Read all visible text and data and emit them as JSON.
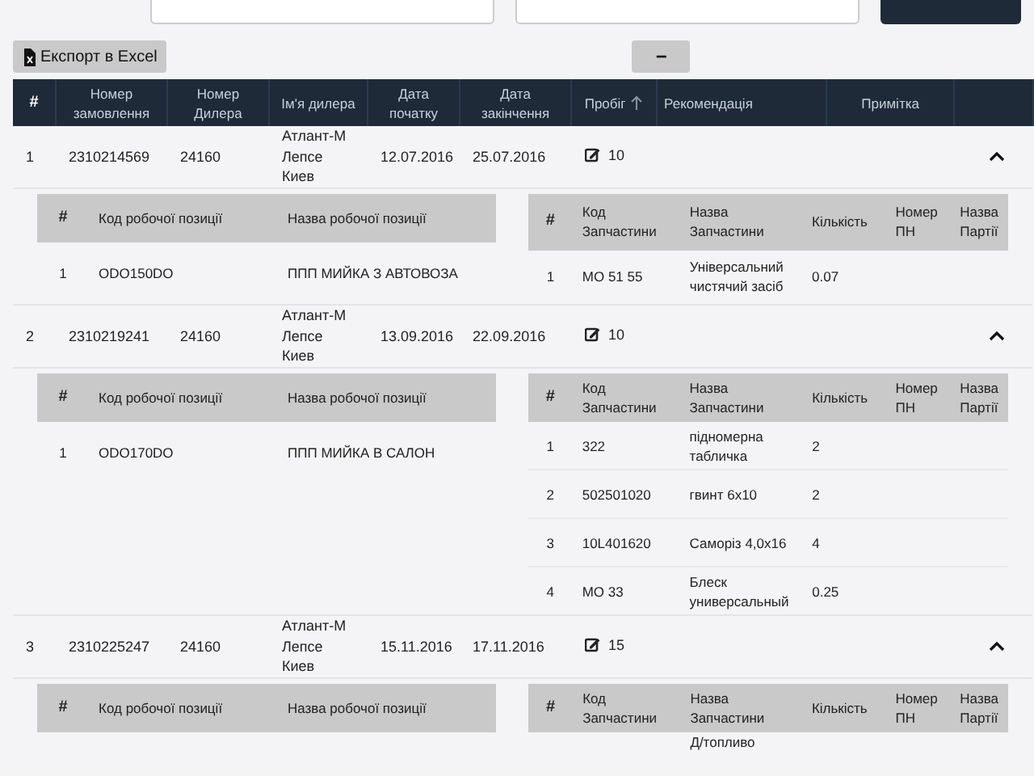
{
  "export_button": "Експорт в Excel",
  "collapse_button": "−",
  "table": {
    "columns": [
      {
        "label": "#",
        "sorted": false
      },
      {
        "label": "Номер замовлення",
        "sorted": false
      },
      {
        "label": "Номер Дилера",
        "sorted": false
      },
      {
        "label": "Ім'я дилера",
        "sorted": false
      },
      {
        "label": "Дата початку",
        "sorted": false
      },
      {
        "label": "Дата закінчення",
        "sorted": false
      },
      {
        "label": "Пробіг",
        "sorted": true
      },
      {
        "label": "Рекомендація",
        "sorted": false
      },
      {
        "label": "Примітка",
        "sorted": false
      }
    ],
    "rows": [
      {
        "n": "1",
        "order": "2310214569",
        "dealer_no": "24160",
        "dealer_name": "Атлант-М\nЛепсе\nКиев",
        "start": "12.07.2016",
        "end": "25.07.2016",
        "mileage": "10",
        "expanded": true,
        "work_columns": [
          "#",
          "Код робочої позиції",
          "Назва робочої позиції"
        ],
        "works": [
          {
            "n": "1",
            "code": "ODO150DO",
            "name": "ППП МИЙКА З АВТОВОЗА"
          }
        ],
        "part_columns": [
          "#",
          "Код Запчастини",
          "Назва Запчастини",
          "Кількість",
          "Номер ПН",
          "Назва Партії"
        ],
        "parts": [
          {
            "n": "1",
            "code": "MO 51 55",
            "name": "Універсальний чистячий засіб",
            "qty": "0.07"
          }
        ]
      },
      {
        "n": "2",
        "order": "2310219241",
        "dealer_no": "24160",
        "dealer_name": "Атлант-М\nЛепсе\nКиев",
        "start": "13.09.2016",
        "end": "22.09.2016",
        "mileage": "10",
        "expanded": true,
        "work_columns": [
          "#",
          "Код робочої позиції",
          "Назва робочої позиції"
        ],
        "works": [
          {
            "n": "1",
            "code": "ODO170DO",
            "name": "ППП МИЙКА В САЛОН"
          }
        ],
        "part_columns": [
          "#",
          "Код Запчастини",
          "Назва Запчастини",
          "Кількість",
          "Номер ПН",
          "Назва Партії"
        ],
        "parts": [
          {
            "n": "1",
            "code": "322",
            "name": "підномерна табличка",
            "qty": "2"
          },
          {
            "n": "2",
            "code": "502501020",
            "name": "гвинт 6x10",
            "qty": "2"
          },
          {
            "n": "3",
            "code": "10L401620",
            "name": "Саморіз 4,0x16",
            "qty": "4"
          },
          {
            "n": "4",
            "code": "MO 33",
            "name": "Блеск универсальный",
            "qty": "0.25"
          }
        ]
      },
      {
        "n": "3",
        "order": "2310225247",
        "dealer_no": "24160",
        "dealer_name": "Атлант-М\nЛепсе\nКиев",
        "start": "15.11.2016",
        "end": "17.11.2016",
        "mileage": "15",
        "expanded": true,
        "work_columns": [
          "#",
          "Код робочої позиції",
          "Назва робочої позиції"
        ],
        "part_columns": [
          "#",
          "Код Запчастини",
          "Назва Запчастини",
          "Кількість",
          "Номер ПН",
          "Назва Партії"
        ],
        "parts": [
          {
            "name": "Д/топливо"
          }
        ]
      }
    ]
  }
}
